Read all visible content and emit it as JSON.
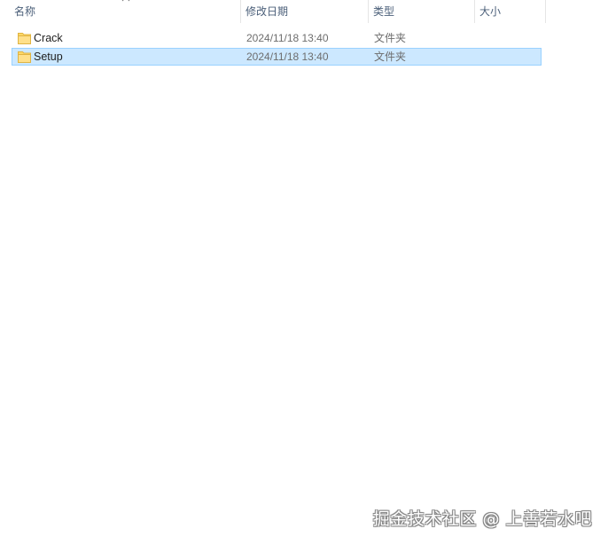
{
  "columns": {
    "name": "名称",
    "modified": "修改日期",
    "type": "类型",
    "size": "大小"
  },
  "files": [
    {
      "name": "Crack",
      "modified": "2024/11/18 13:40",
      "type": "文件夹",
      "size": "",
      "icon": "folder-icon",
      "selected": false
    },
    {
      "name": "Setup",
      "modified": "2024/11/18 13:40",
      "type": "文件夹",
      "size": "",
      "icon": "folder-icon",
      "selected": true
    }
  ],
  "watermark": "掘金技术社区 @ 上善若水吧",
  "colors": {
    "selection_bg": "#cce8ff",
    "selection_border": "#99d1ff",
    "folder": "#ffd866"
  }
}
